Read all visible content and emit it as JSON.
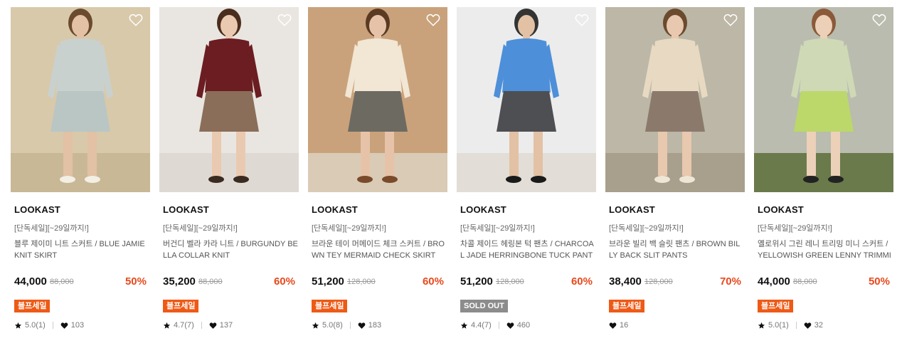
{
  "products": [
    {
      "brand": "LOOKAST",
      "promo": "[단독세일][~29일까지!]",
      "name": "블루 제이미 니트 스커트 / BLUE JAMIE KNIT SKIRT",
      "price": "44,000",
      "original_price": "88,000",
      "discount": "50%",
      "badge": "블프세일",
      "badge_type": "sale",
      "rating": "5.0(1)",
      "likes": "103",
      "image": {
        "bg": "#d8c9ab",
        "floor": "#c9b896",
        "top": "#c9d1cf",
        "bottom": "#b9c6c4",
        "skin": "#e2c1a4",
        "shoe": "#f4efe5",
        "hair": "#6b4a2e"
      }
    },
    {
      "brand": "LOOKAST",
      "promo": "[단독세일][~29일까지!]",
      "name": "버건디 벨라 카라 니트 / BURGUNDY BELLA COLLAR KNIT",
      "price": "35,200",
      "original_price": "88,000",
      "discount": "60%",
      "badge": "블프세일",
      "badge_type": "sale",
      "rating": "4.7(7)",
      "likes": "137",
      "image": {
        "bg": "#e9e6e1",
        "floor": "#dedad3",
        "top": "#6b1d22",
        "bottom": "#8a6e5a",
        "skin": "#eac9b1",
        "shoe": "#3a2a20",
        "hair": "#4a2d1c"
      }
    },
    {
      "brand": "LOOKAST",
      "promo": "[단독세일][~29일까지!]",
      "name": "브라운 테이 머메이드 체크 스커트 / BROWN TEY MERMAID CHECK SKIRT",
      "price": "51,200",
      "original_price": "128,000",
      "discount": "60%",
      "badge": "블프세일",
      "badge_type": "sale",
      "rating": "5.0(8)",
      "likes": "183",
      "image": {
        "bg": "#c9a27b",
        "floor": "#d9cbb6",
        "top": "#f2e6d4",
        "bottom": "#6d6a62",
        "skin": "#e6c3a8",
        "shoe": "#7a4a2a",
        "hair": "#5a3a22"
      }
    },
    {
      "brand": "LOOKAST",
      "promo": "[단독세일][~29일까지!]",
      "name": "차콜 제이드 헤링본 턱 팬츠 / CHARCOAL JADE HERRINGBONE TUCK PANTS",
      "price": "51,200",
      "original_price": "128,000",
      "discount": "60%",
      "badge": "SOLD OUT",
      "badge_type": "soldout",
      "rating": "4.4(7)",
      "likes": "460",
      "image": {
        "bg": "#ececec",
        "floor": "#e2ddd6",
        "top": "#4d8fd9",
        "bottom": "#4e4f52",
        "skin": "#e2c1a4",
        "shoe": "#1a1a1a",
        "hair": "#333"
      }
    },
    {
      "brand": "LOOKAST",
      "promo": "[단독세일][~29일까지!]",
      "name": "브라운 빌리 백 슬릿 팬츠 / BROWN BILLY BACK SLIT PANTS",
      "price": "38,400",
      "original_price": "128,000",
      "discount": "70%",
      "badge": "블프세일",
      "badge_type": "sale",
      "rating": "",
      "likes": "16",
      "image": {
        "bg": "#bcb7a6",
        "floor": "#a8a08c",
        "top": "#e8d9c2",
        "bottom": "#8b7a6c",
        "skin": "#e8c8ae",
        "shoe": "#efe6d6",
        "hair": "#6b4a2e"
      }
    },
    {
      "brand": "LOOKAST",
      "promo": "[단독세일][~29일까지!]",
      "name": "옐로위시 그린 레니 트리밍 미니 스커트 / YELLOWISH GREEN LENNY TRIMMING MINI SKIRT",
      "price": "44,000",
      "original_price": "88,000",
      "discount": "50%",
      "badge": "블프세일",
      "badge_type": "sale",
      "rating": "5.0(1)",
      "likes": "32",
      "image": {
        "bg": "#b9bcae",
        "floor": "#6a7a4a",
        "top": "#cfd9b6",
        "bottom": "#bcd86a",
        "skin": "#ecd0b8",
        "shoe": "#222",
        "hair": "#8a5a3a"
      }
    }
  ],
  "colors": {
    "accent": "#e8491d",
    "sale_badge": "#ee5a16",
    "soldout_badge": "#8c8c8c"
  },
  "icons": {
    "wishlist": "heart-outline-icon",
    "rating": "star-icon",
    "likes": "heart-filled-icon"
  }
}
